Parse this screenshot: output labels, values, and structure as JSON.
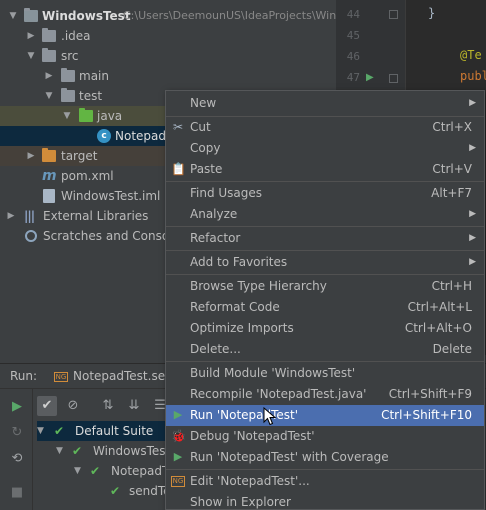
{
  "project_tree": {
    "root_label": "WindowsTest",
    "root_path": "C:\\Users\\DeemounUS\\IdeaProjects\\Wind",
    "idea": ".idea",
    "src": "src",
    "main": "main",
    "test": "test",
    "java": "java",
    "selected_file": "NotepadT",
    "target": "target",
    "pom": "pom.xml",
    "iml": "WindowsTest.iml",
    "libs": "External Libraries",
    "scratches": "Scratches and Consoles"
  },
  "editor": {
    "line_numbers": [
      "44",
      "45",
      "46",
      "47"
    ],
    "brace": "}",
    "annotation": "@Te",
    "keyword": "publ"
  },
  "run_panel": {
    "run_label": "Run:",
    "config_name": "NotepadTest.send",
    "suite": "Default Suite",
    "module": "WindowsTest",
    "class": "NotepadTe",
    "method": "sendTe"
  },
  "context_menu": {
    "new": "New",
    "cut": "Cut",
    "cut_shortcut": "Ctrl+X",
    "copy": "Copy",
    "paste": "Paste",
    "paste_shortcut": "Ctrl+V",
    "find_usages": "Find Usages",
    "find_usages_shortcut": "Alt+F7",
    "analyze": "Analyze",
    "refactor": "Refactor",
    "add_to_favorites": "Add to Favorites",
    "browse_type_hierarchy": "Browse Type Hierarchy",
    "browse_type_hierarchy_shortcut": "Ctrl+H",
    "reformat_code": "Reformat Code",
    "reformat_code_shortcut": "Ctrl+Alt+L",
    "optimize_imports": "Optimize Imports",
    "optimize_imports_shortcut": "Ctrl+Alt+O",
    "delete": "Delete...",
    "delete_shortcut": "Delete",
    "build_module": "Build Module 'WindowsTest'",
    "recompile": "Recompile 'NotepadTest.java'",
    "recompile_shortcut": "Ctrl+Shift+F9",
    "run": "Run 'NotepadTest'",
    "run_shortcut": "Ctrl+Shift+F10",
    "debug": "Debug 'NotepadTest'",
    "run_coverage": "Run 'NotepadTest' with Coverage",
    "edit": "Edit 'NotepadTest'...",
    "show_in_explorer": "Show in Explorer"
  },
  "colors": {
    "menu_highlight": "#4b6eaf",
    "run_green": "#59a869",
    "folder_green": "#62b543",
    "folder_orange": "#d18c3a"
  }
}
